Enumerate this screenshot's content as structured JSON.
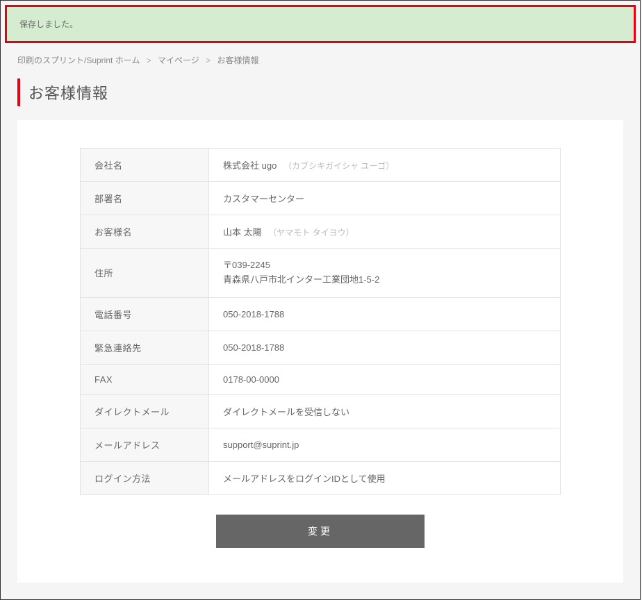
{
  "alert": {
    "message": "保存しました。"
  },
  "breadcrumb": {
    "home": "印刷のスプリント/Suprint ホーム",
    "mypage": "マイページ",
    "current": "お客様情報"
  },
  "page": {
    "title": "お客様情報"
  },
  "info": {
    "labels": {
      "company": "会社名",
      "department": "部署名",
      "customer": "お客様名",
      "address": "住所",
      "tel": "電話番号",
      "emergency": "緊急連絡先",
      "fax": "FAX",
      "dm": "ダイレクトメール",
      "email": "メールアドレス",
      "login": "ログイン方法"
    },
    "company": {
      "value": "株式会社 ugo",
      "kana": "（カブシキガイシャ ユーゴ）"
    },
    "department": "カスタマーセンター",
    "customer": {
      "value": "山本 太陽",
      "kana": "（ヤマモト タイヨウ）"
    },
    "address": {
      "postal": "〒039-2245",
      "line": "青森県八戸市北インター工業団地1-5-2"
    },
    "tel": "050-2018-1788",
    "emergency": "050-2018-1788",
    "fax": "0178-00-0000",
    "dm": "ダイレクトメールを受信しない",
    "email": "support@suprint.jp",
    "login": "メールアドレスをログインIDとして使用"
  },
  "buttons": {
    "change": "変更"
  }
}
